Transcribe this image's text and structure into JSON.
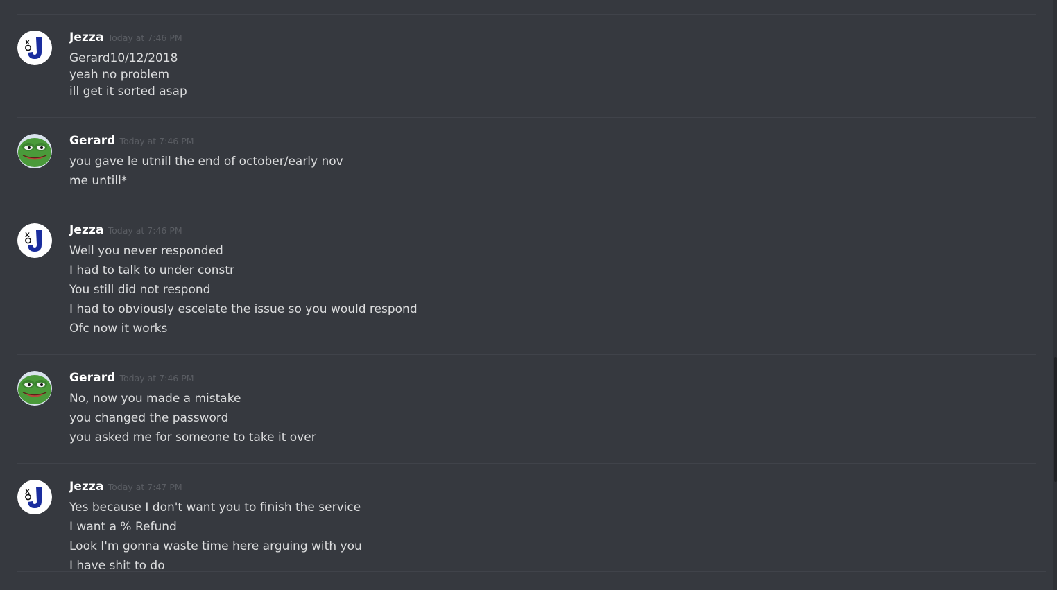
{
  "messages": [
    {
      "author": "Jezza",
      "avatar_icon": "jezza-avatar-icon",
      "timestamp": "Today at 7:46 PM",
      "lines": [
        "Gerard10/12/2018",
        "yeah no problem",
        "ill get it sorted asap"
      ]
    },
    {
      "author": "Gerard",
      "avatar_icon": "pepe-avatar-icon",
      "timestamp": "Today at 7:46 PM",
      "lines": [
        "you gave le utnill the end of october/early nov",
        "me untill*"
      ]
    },
    {
      "author": "Jezza",
      "avatar_icon": "jezza-avatar-icon",
      "timestamp": "Today at 7:46 PM",
      "lines": [
        "Well you never responded",
        "I had to talk to under constr",
        "You still did not respond",
        "I had to obviously escelate the issue so you would respond",
        "Ofc now it works"
      ]
    },
    {
      "author": "Gerard",
      "avatar_icon": "pepe-avatar-icon",
      "timestamp": "Today at 7:46 PM",
      "lines": [
        "No, now you made a mistake",
        "you changed the password",
        "you asked me for someone to take it over"
      ]
    },
    {
      "author": "Jezza",
      "avatar_icon": "jezza-avatar-icon",
      "timestamp": "Today at 7:47 PM",
      "lines": [
        "Yes because I don't want you to finish the service",
        "I want a % Refund",
        "Look I'm gonna waste time here arguing with you",
        "I have shit to do"
      ]
    }
  ],
  "colors": {
    "background": "#36393f",
    "username": "#ffffff",
    "message_text": "#dcddde",
    "timestamp": "#5a5d63",
    "divider": "#40434a",
    "jezza_logo_blue": "#1a2d9e",
    "pepe_green": "#4a9a3a"
  }
}
